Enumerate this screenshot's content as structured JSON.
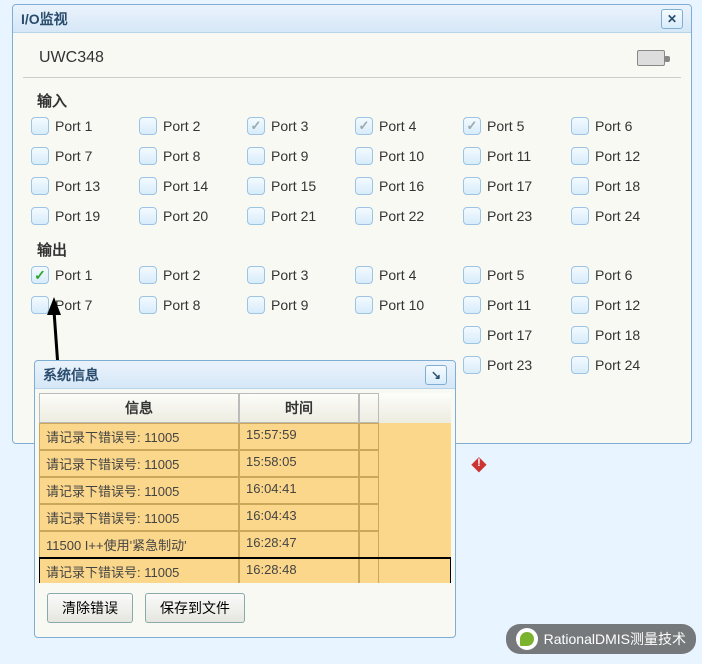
{
  "io_monitor": {
    "title": "I/O监视",
    "device_name": "UWC348",
    "input_label": "输入",
    "output_label": "输出",
    "input_ports": [
      {
        "label": "Port 1",
        "checked": false
      },
      {
        "label": "Port 2",
        "checked": false
      },
      {
        "label": "Port 3",
        "checked": "grey"
      },
      {
        "label": "Port 4",
        "checked": "grey"
      },
      {
        "label": "Port 5",
        "checked": "grey"
      },
      {
        "label": "Port 6",
        "checked": false
      },
      {
        "label": "Port 7",
        "checked": false
      },
      {
        "label": "Port 8",
        "checked": false
      },
      {
        "label": "Port 9",
        "checked": false
      },
      {
        "label": "Port 10",
        "checked": false
      },
      {
        "label": "Port 11",
        "checked": false
      },
      {
        "label": "Port 12",
        "checked": false
      },
      {
        "label": "Port 13",
        "checked": false
      },
      {
        "label": "Port 14",
        "checked": false
      },
      {
        "label": "Port 15",
        "checked": false
      },
      {
        "label": "Port 16",
        "checked": false
      },
      {
        "label": "Port 17",
        "checked": false
      },
      {
        "label": "Port 18",
        "checked": false
      },
      {
        "label": "Port 19",
        "checked": false
      },
      {
        "label": "Port 20",
        "checked": false
      },
      {
        "label": "Port 21",
        "checked": false
      },
      {
        "label": "Port 22",
        "checked": false
      },
      {
        "label": "Port 23",
        "checked": false
      },
      {
        "label": "Port 24",
        "checked": false
      }
    ],
    "output_ports": [
      {
        "label": "Port 1",
        "checked": "green"
      },
      {
        "label": "Port 2",
        "checked": false
      },
      {
        "label": "Port 3",
        "checked": false
      },
      {
        "label": "Port 4",
        "checked": false
      },
      {
        "label": "Port 5",
        "checked": false
      },
      {
        "label": "Port 6",
        "checked": false
      },
      {
        "label": "Port 7",
        "checked": false
      },
      {
        "label": "Port 8",
        "checked": false
      },
      {
        "label": "Port 9",
        "checked": false
      },
      {
        "label": "Port 10",
        "checked": false
      },
      {
        "label": "Port 11",
        "checked": false
      },
      {
        "label": "Port 12",
        "checked": false
      },
      {
        "label": "Port 17",
        "checked": false
      },
      {
        "label": "Port 18",
        "checked": false
      },
      {
        "label": "Port 23",
        "checked": false
      },
      {
        "label": "Port 24",
        "checked": false
      }
    ]
  },
  "sys_info": {
    "title": "系统信息",
    "columns": {
      "info": "信息",
      "time": "时间"
    },
    "rows": [
      {
        "info": "请记录下错误号: 11005",
        "time": "15:57:59",
        "hl": false
      },
      {
        "info": "请记录下错误号: 11005",
        "time": "15:58:05",
        "hl": false
      },
      {
        "info": "请记录下错误号: 11005",
        "time": "16:04:41",
        "hl": false
      },
      {
        "info": "请记录下错误号: 11005",
        "time": "16:04:43",
        "hl": false
      },
      {
        "info": "11500 I++使用'紧急制动'",
        "time": "16:28:47",
        "hl": false
      },
      {
        "info": "请记录下错误号: 11005",
        "time": "16:28:48",
        "hl": true
      }
    ],
    "buttons": {
      "clear": "清除错误",
      "save": "保存到文件"
    }
  },
  "footer": {
    "text": "RationalDMIS测量技术"
  }
}
